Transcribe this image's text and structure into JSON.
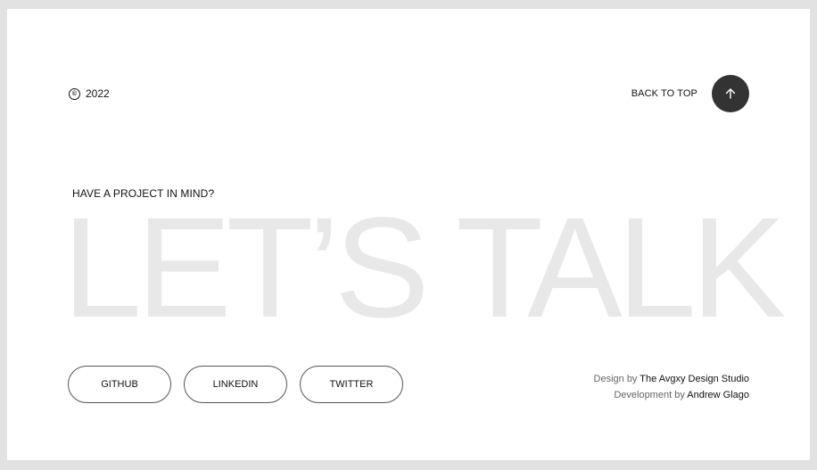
{
  "footer": {
    "copyright": {
      "symbol": "©",
      "year": "2022"
    },
    "back_to_top": {
      "label": "BACK TO TOP",
      "icon": "arrow-up-icon"
    },
    "kicker": "HAVE A PROJECT IN MIND?",
    "headline": "LET’S TALK",
    "socials": [
      {
        "label": "GITHUB"
      },
      {
        "label": "LINKEDIN"
      },
      {
        "label": "TWITTER"
      }
    ],
    "credits": {
      "design_prefix": "Design by",
      "design_name": "The Avgxy Design Studio",
      "dev_prefix": "Development by",
      "dev_name": "Andrew Glago"
    }
  },
  "colors": {
    "background": "#e2e2e2",
    "card": "#ffffff",
    "headline": "#e8e8e8",
    "button_circle": "#333333"
  }
}
